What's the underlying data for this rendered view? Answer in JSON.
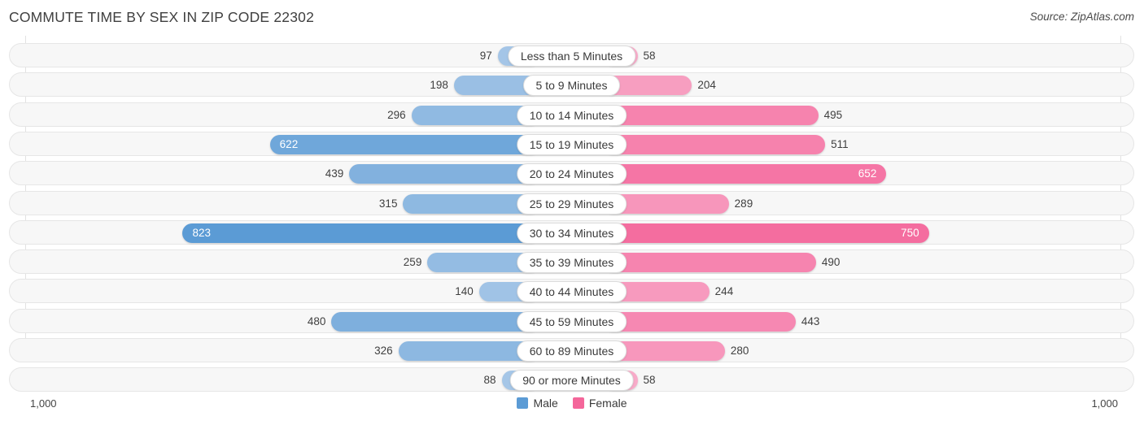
{
  "header": {
    "title": "COMMUTE TIME BY SEX IN ZIP CODE 22302",
    "source": "Source: ZipAtlas.com"
  },
  "axis": {
    "left_tick": "1,000",
    "right_tick": "1,000"
  },
  "legend": {
    "items": [
      {
        "label": "Male",
        "color": "#5b9bd5"
      },
      {
        "label": "Female",
        "color": "#f4669a"
      }
    ]
  },
  "chart_data": {
    "type": "bar",
    "title": "COMMUTE TIME BY SEX IN ZIP CODE 22302",
    "subtitle": "Source: ZipAtlas.com",
    "orientation": "horizontal-diverging",
    "xlabel": "",
    "ylabel": "",
    "xlim": [
      -1000,
      1000
    ],
    "axis_tick_labels": [
      "1,000",
      "1,000"
    ],
    "grid": false,
    "legend_position": "bottom-center",
    "categories": [
      "Less than 5 Minutes",
      "5 to 9 Minutes",
      "10 to 14 Minutes",
      "15 to 19 Minutes",
      "20 to 24 Minutes",
      "25 to 29 Minutes",
      "30 to 34 Minutes",
      "35 to 39 Minutes",
      "40 to 44 Minutes",
      "45 to 59 Minutes",
      "60 to 89 Minutes",
      "90 or more Minutes"
    ],
    "series": [
      {
        "name": "Male",
        "color": "#5b9bd5",
        "values": [
          97,
          198,
          296,
          622,
          439,
          315,
          823,
          259,
          140,
          480,
          326,
          88
        ]
      },
      {
        "name": "Female",
        "color": "#f4669a",
        "values": [
          58,
          204,
          495,
          511,
          652,
          289,
          750,
          490,
          244,
          443,
          280,
          58
        ]
      }
    ]
  },
  "rows": [
    {
      "label": "Less than 5 Minutes",
      "male": "97",
      "female": "58",
      "male_v": 97,
      "female_v": 58
    },
    {
      "label": "5 to 9 Minutes",
      "male": "198",
      "female": "204",
      "male_v": 198,
      "female_v": 204
    },
    {
      "label": "10 to 14 Minutes",
      "male": "296",
      "female": "495",
      "male_v": 296,
      "female_v": 495
    },
    {
      "label": "15 to 19 Minutes",
      "male": "622",
      "female": "511",
      "male_v": 622,
      "female_v": 511
    },
    {
      "label": "20 to 24 Minutes",
      "male": "439",
      "female": "652",
      "male_v": 439,
      "female_v": 652
    },
    {
      "label": "25 to 29 Minutes",
      "male": "315",
      "female": "289",
      "male_v": 315,
      "female_v": 289
    },
    {
      "label": "30 to 34 Minutes",
      "male": "823",
      "female": "750",
      "male_v": 823,
      "female_v": 750
    },
    {
      "label": "35 to 39 Minutes",
      "male": "259",
      "female": "490",
      "male_v": 259,
      "female_v": 490
    },
    {
      "label": "40 to 44 Minutes",
      "male": "140",
      "female": "244",
      "male_v": 140,
      "female_v": 244
    },
    {
      "label": "45 to 59 Minutes",
      "male": "480",
      "female": "443",
      "male_v": 480,
      "female_v": 443
    },
    {
      "label": "60 to 89 Minutes",
      "male": "326",
      "female": "280",
      "male_v": 326,
      "female_v": 280
    },
    {
      "label": "90 or more Minutes",
      "male": "88",
      "female": "58",
      "male_v": 88,
      "female_v": 58
    }
  ]
}
